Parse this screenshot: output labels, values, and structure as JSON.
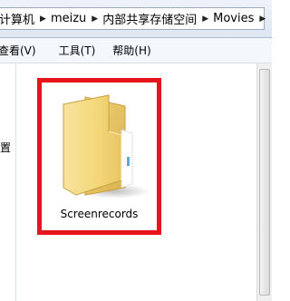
{
  "address_bar": {
    "crumbs": [
      "计算机",
      "meizu",
      "内部共享存储空间",
      "Movies"
    ],
    "separator": "▶"
  },
  "menu_bar": {
    "items": [
      "查看(V)",
      "工具(T)",
      "帮助(H)"
    ]
  },
  "nav_pane": {
    "partial_label": "位置"
  },
  "content": {
    "items": [
      {
        "name": "Screenrecords",
        "type": "folder",
        "icon": "folder-icon",
        "selected_highlight": true
      }
    ]
  },
  "colors": {
    "highlight_border": "#e8141c",
    "folder_body": "#f3d778",
    "folder_back": "#e6c25a"
  }
}
